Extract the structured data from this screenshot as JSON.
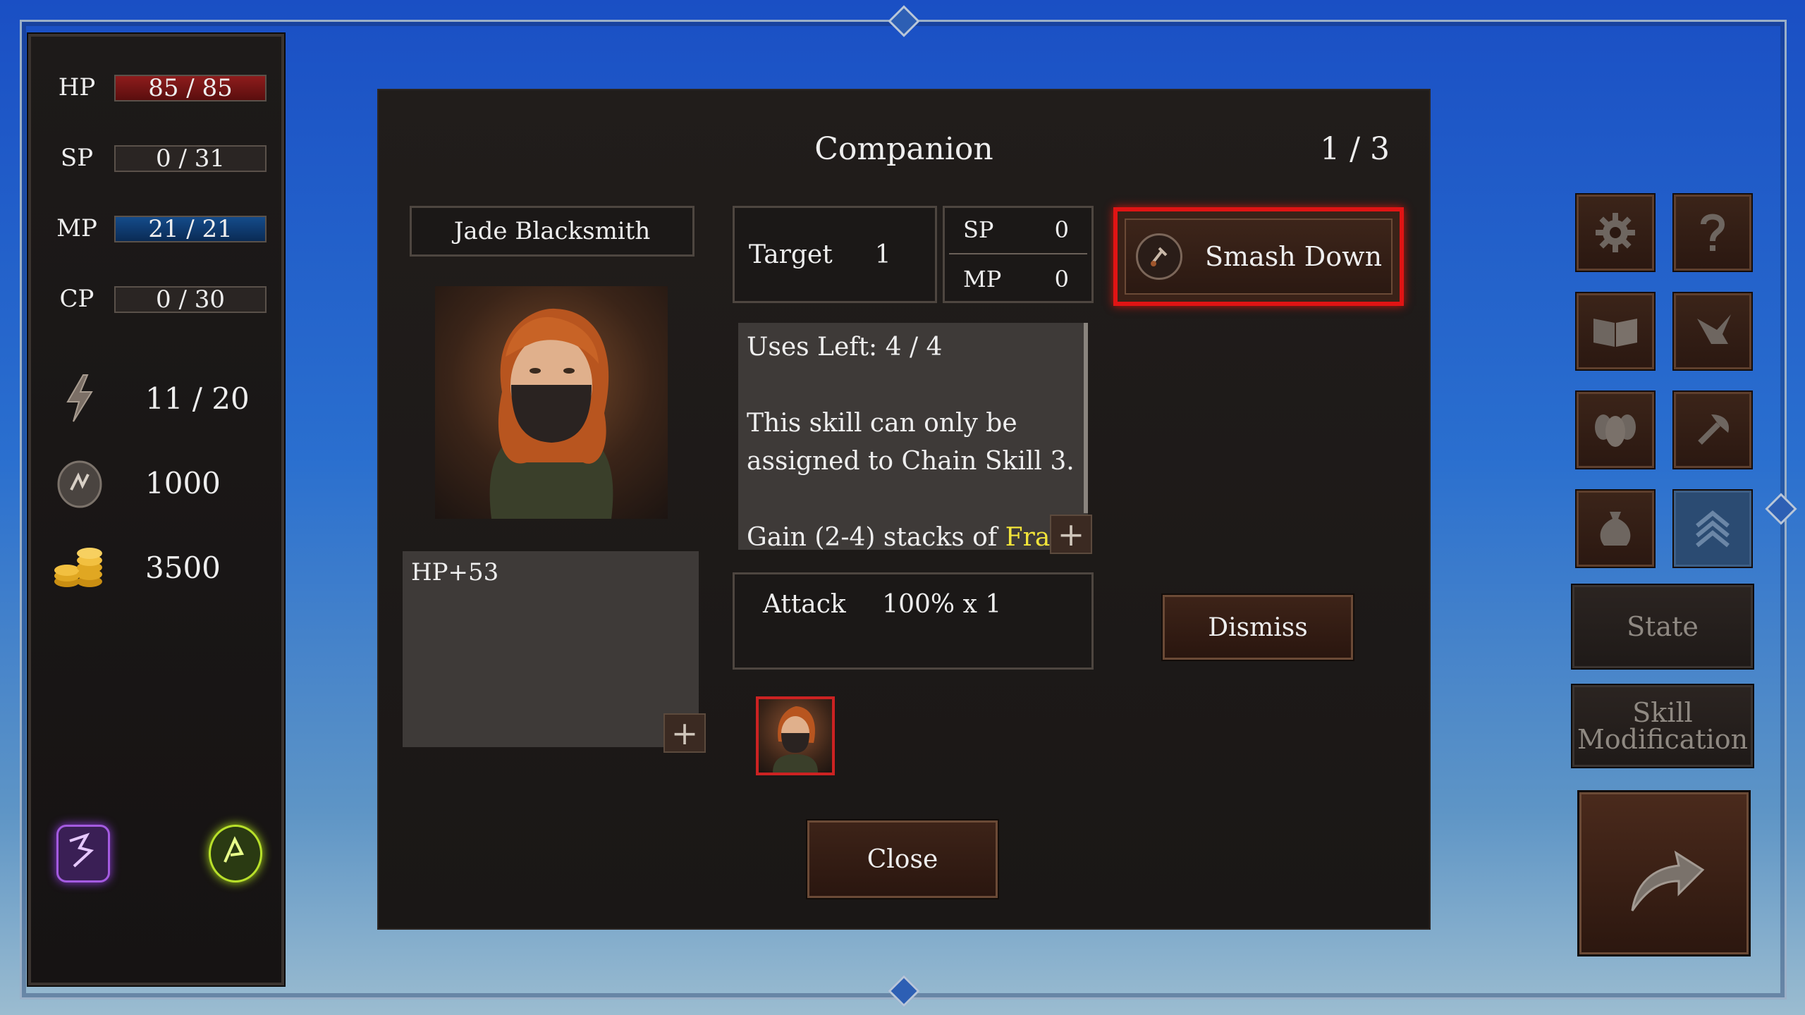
{
  "stats": [
    {
      "label": "HP",
      "value": "85 / 85"
    },
    {
      "label": "SP",
      "value": "0 / 31"
    },
    {
      "label": "MP",
      "value": "21 / 21"
    },
    {
      "label": "CP",
      "value": "0 / 30"
    }
  ],
  "resources": [
    {
      "icon": "lightning-icon",
      "value": "11 / 20"
    },
    {
      "icon": "rune-stone-icon",
      "value": "1000"
    },
    {
      "icon": "gold-coins-icon",
      "value": "3500"
    }
  ],
  "panel": {
    "title": "Companion",
    "page": "1 / 3",
    "companion_name": "Jade Blacksmith",
    "bonus": "HP+53",
    "target_label": "Target",
    "target_value": "1",
    "sp_label": "SP",
    "sp_value": "0",
    "mp_label": "MP",
    "mp_value": "0",
    "uses_left": "Uses Left: 4 / 4",
    "desc_line1": "This skill can only be",
    "desc_line2": "assigned to Chain Skill 3.",
    "desc_line3_prefix": "Gain (2-4) stacks of",
    "desc_keyword": "Frail",
    "attack_label": "Attack",
    "attack_value": "100% x 1",
    "skill_name": "Smash Down",
    "dismiss_label": "Dismiss",
    "close_label": "Close"
  },
  "sidebar_right": {
    "state_label": "State",
    "skill_mod_line1": "Skill",
    "skill_mod_line2": "Modification"
  }
}
